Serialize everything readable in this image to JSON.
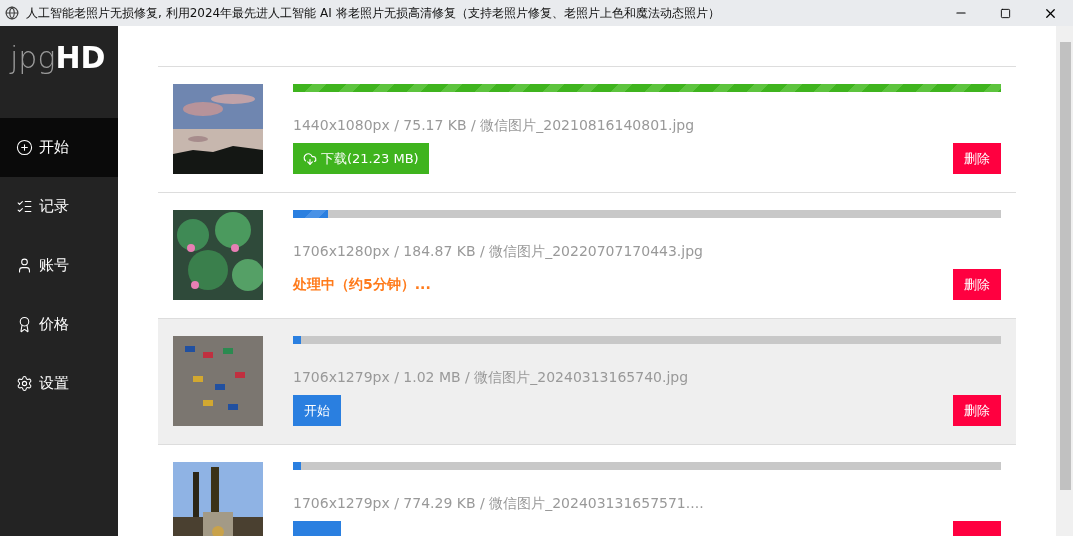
{
  "window": {
    "title": "人工智能老照片无损修复, 利用2024年最先进人工智能 AI 将老照片无损高清修复（支持老照片修复、老照片上色和魔法动态照片）"
  },
  "logo": {
    "light": "jpg",
    "bold": "HD"
  },
  "sidebar": {
    "items": [
      {
        "label": "开始",
        "selected": true
      },
      {
        "label": "记录",
        "selected": false
      },
      {
        "label": "账号",
        "selected": false
      },
      {
        "label": "价格",
        "selected": false
      },
      {
        "label": "设置",
        "selected": false
      }
    ]
  },
  "files": [
    {
      "kind": "done",
      "selected": false,
      "level": 1,
      "info": "1440x1080px / 75.17 KB / 微信图片_20210816140801.jpg",
      "action": "下载(21.23 MB)",
      "delete": "删除"
    },
    {
      "kind": "processing",
      "selected": false,
      "level": 0.05,
      "info": "1706x1280px / 184.87 KB / 微信图片_20220707170443.jpg",
      "action": "处理中（约5分钟）...",
      "delete": "删除"
    },
    {
      "kind": "idle",
      "selected": true,
      "level": 0.01,
      "info": "1706x1279px / 1.02 MB / 微信图片_20240313165740.jpg",
      "action": "开始",
      "delete": "删除"
    },
    {
      "kind": "idle",
      "selected": false,
      "level": 0.01,
      "info": "1706x1279px / 774.29 KB / 微信图片_202403131657571...."
    }
  ]
}
